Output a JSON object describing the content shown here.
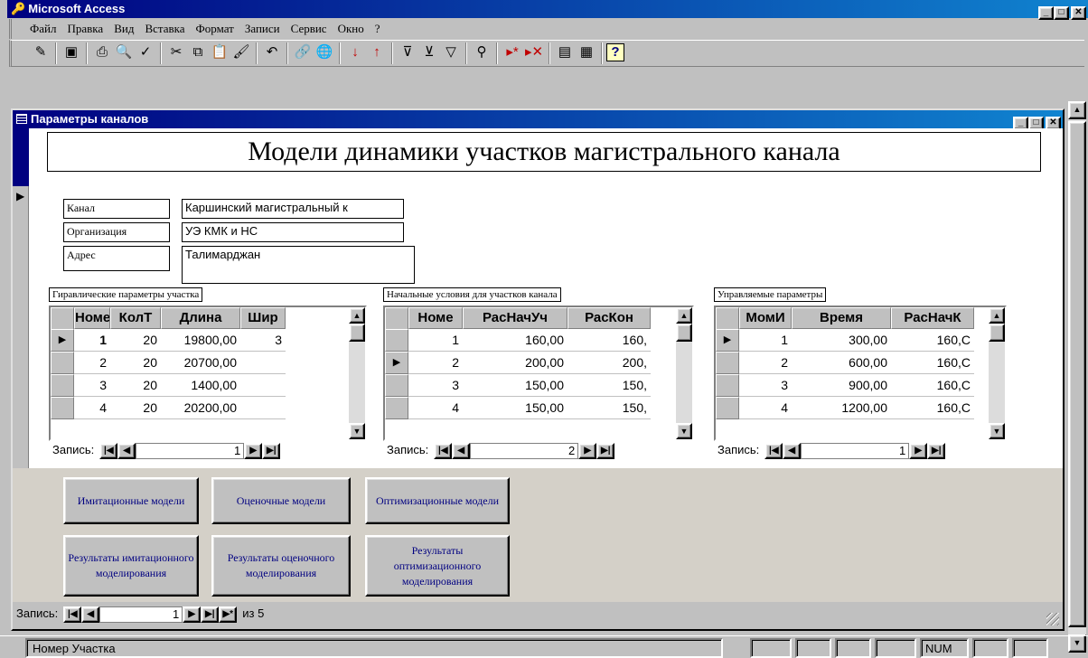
{
  "app": {
    "title": "Microsoft Access"
  },
  "menu": [
    "Файл",
    "Правка",
    "Вид",
    "Вставка",
    "Формат",
    "Записи",
    "Сервис",
    "Окно",
    "?"
  ],
  "toolbar": {
    "icons": [
      "design-view-icon",
      "save-icon",
      "print-icon",
      "print-preview-icon",
      "spelling-icon",
      "cut-icon",
      "copy-icon",
      "paste-icon",
      "format-painter-icon",
      "undo-icon",
      "insert-hyperlink-icon",
      "web-toolbar-icon",
      "sort-ascending-icon",
      "sort-descending-icon",
      "filter-by-selection-icon",
      "filter-by-form-icon",
      "apply-filter-icon",
      "find-icon",
      "new-record-icon",
      "delete-record-icon",
      "database-window-icon",
      "new-object-icon",
      "help-icon"
    ]
  },
  "form": {
    "title": "Параметры каналов",
    "heading": "Модели динамики участков магистрального канала",
    "fields": [
      {
        "label": "Канал",
        "value": "Каршинский магистральный к"
      },
      {
        "label": "Организация",
        "value": "УЭ КМК и НС"
      },
      {
        "label": "Адрес",
        "value": "Талимарджан"
      }
    ],
    "grids": [
      {
        "caption": "Гиравлические параметры участка",
        "columns": [
          "Номе",
          "КолТ",
          "Длина",
          "Шир"
        ],
        "rows": [
          [
            "1",
            "20",
            "19800,00",
            "3"
          ],
          [
            "2",
            "20",
            "20700,00",
            ""
          ],
          [
            "3",
            "20",
            "1400,00",
            ""
          ],
          [
            "4",
            "20",
            "20200,00",
            ""
          ]
        ],
        "current_row": 0,
        "nav_label": "Запись:",
        "record": "1"
      },
      {
        "caption": "Начальные условия для участков канала",
        "columns": [
          "Номе",
          "РасНачУч",
          "РасКон"
        ],
        "rows": [
          [
            "1",
            "160,00",
            "160,"
          ],
          [
            "2",
            "200,00",
            "200,"
          ],
          [
            "3",
            "150,00",
            "150,"
          ],
          [
            "4",
            "150,00",
            "150,"
          ]
        ],
        "current_row": 1,
        "nav_label": "Запись:",
        "record": "2"
      },
      {
        "caption": "Управляемые параметры",
        "columns": [
          "МомИ",
          "Время",
          "РасНачК"
        ],
        "rows": [
          [
            "1",
            "300,00",
            "160,С"
          ],
          [
            "2",
            "600,00",
            "160,С"
          ],
          [
            "3",
            "900,00",
            "160,С"
          ],
          [
            "4",
            "1200,00",
            "160,С"
          ]
        ],
        "current_row": 0,
        "nav_label": "Запись:",
        "record": "1"
      }
    ],
    "buttons": [
      "Имитационные модели",
      "Оценочные модели",
      "Оптимизационные модели",
      "Результаты имитационного моделирования",
      "Результаты оценочного моделирования",
      "Результаты оптимизационного моделирования"
    ],
    "nav": {
      "label": "Запись:",
      "record": "1",
      "of_label": "из 5"
    }
  },
  "status": {
    "text": "Номер Участка",
    "num": "NUM"
  }
}
